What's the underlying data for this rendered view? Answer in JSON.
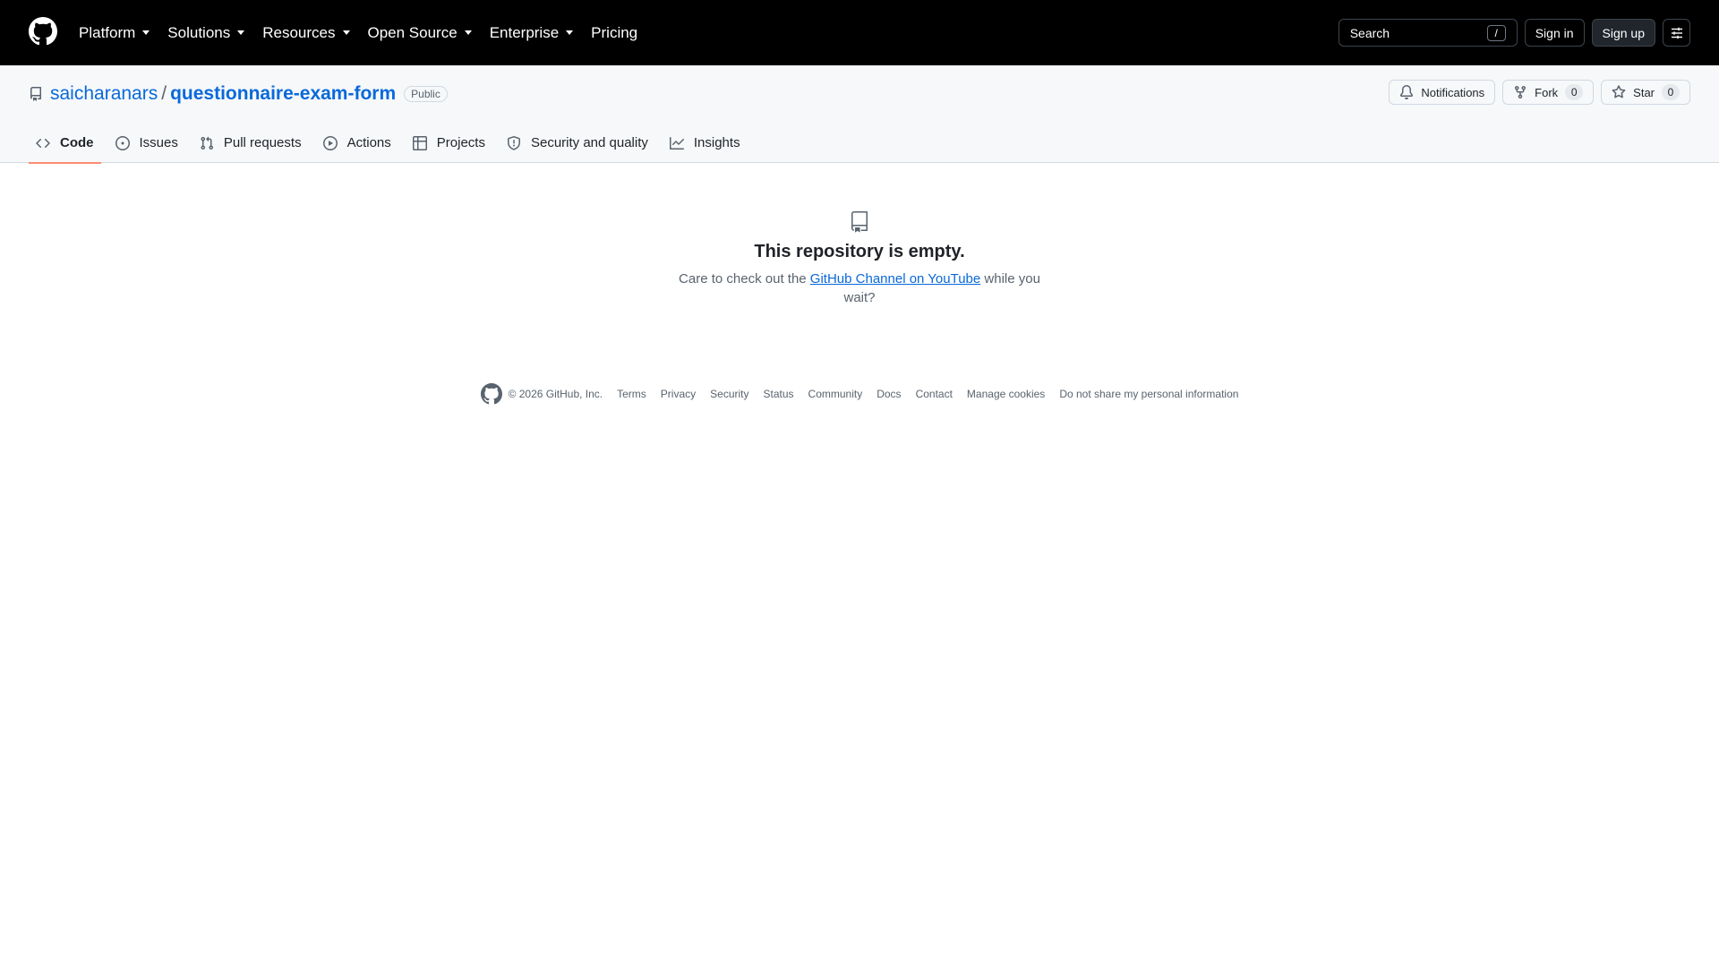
{
  "header": {
    "nav": [
      {
        "label": "Platform",
        "has_caret": true
      },
      {
        "label": "Solutions",
        "has_caret": true
      },
      {
        "label": "Resources",
        "has_caret": true
      },
      {
        "label": "Open Source",
        "has_caret": true
      },
      {
        "label": "Enterprise",
        "has_caret": true
      },
      {
        "label": "Pricing",
        "has_caret": false
      }
    ],
    "search_label": "Search",
    "search_shortcut": "/",
    "sign_in": "Sign in",
    "sign_up": "Sign up"
  },
  "repo": {
    "owner": "saicharanars",
    "separator": "/",
    "name": "questionnaire-exam-form",
    "visibility": "Public",
    "notifications_label": "Notifications",
    "fork_label": "Fork",
    "fork_count": "0",
    "star_label": "Star",
    "star_count": "0",
    "tabs": [
      {
        "label": "Code",
        "icon": "code-icon",
        "selected": true
      },
      {
        "label": "Issues",
        "icon": "issue-icon",
        "selected": false
      },
      {
        "label": "Pull requests",
        "icon": "pull-request-icon",
        "selected": false
      },
      {
        "label": "Actions",
        "icon": "play-icon",
        "selected": false
      },
      {
        "label": "Projects",
        "icon": "table-icon",
        "selected": false
      },
      {
        "label": "Security and quality",
        "icon": "shield-icon",
        "selected": false
      },
      {
        "label": "Insights",
        "icon": "graph-icon",
        "selected": false
      }
    ]
  },
  "empty_state": {
    "title": "This repository is empty.",
    "text_before": "Care to check out the ",
    "link": "GitHub Channel on YouTube",
    "text_after": " while you wait?"
  },
  "footer": {
    "copyright": "© 2026 GitHub, Inc.",
    "links": [
      "Terms",
      "Privacy",
      "Security",
      "Status",
      "Community",
      "Docs",
      "Contact",
      "Manage cookies",
      "Do not share my personal information"
    ]
  },
  "colors": {
    "header_bg": "#000000",
    "link": "#0969da",
    "tab_underline": "#fd8c73",
    "repo_header_bg": "#f6f8fa"
  }
}
